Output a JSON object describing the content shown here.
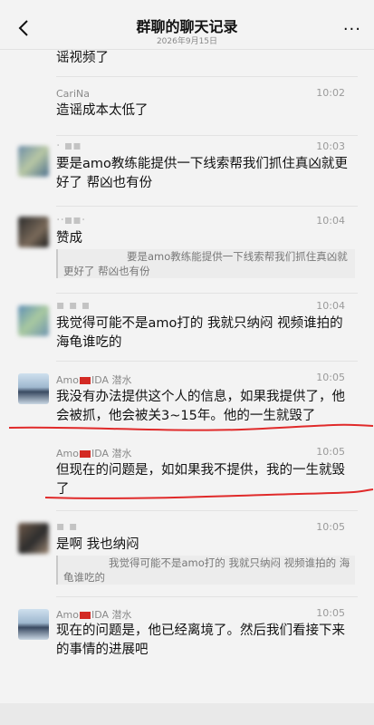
{
  "header": {
    "title": "群聊的聊天记录",
    "date": "2026年9月15日",
    "more": "···"
  },
  "messages": [
    {
      "text": "谣视频了"
    },
    {
      "name": "CariNa",
      "time": "10:02",
      "text": "造谣成本太低了"
    },
    {
      "name": "· ▪▪",
      "time": "10:03",
      "text": "要是amo教练能提供一下线索帮我们抓住真凶就更好了 帮凶也有份"
    },
    {
      "name": "··▪▪·",
      "time": "10:04",
      "text": "赞成",
      "quote": "要是amo教练能提供一下线索帮我们抓住真凶就更好了 帮凶也有份"
    },
    {
      "name": "▪ ▪ ▪",
      "time": "10:04",
      "text": "我觉得可能不是amo打的       我就只纳闷 视频谁拍的   海龟谁吃的"
    },
    {
      "name_pre": "Amo",
      "name_post": "IDA 潜水",
      "time": "10:05",
      "text": "我没有办法提供这个人的信息，如果我提供了，他会被抓，他会被关3~15年。他的一生就毁了"
    },
    {
      "name_pre": "Amo",
      "name_post": "IDA 潜水",
      "time": "10:05",
      "text": "但现在的问题是，如如果我不提供，我的一生就毁了"
    },
    {
      "name": "▪ ▪",
      "time": "10:05",
      "text": "是啊 我也纳闷",
      "quote": "我觉得可能不是amo打的       我就只纳闷 视频谁拍的  海龟谁吃的"
    },
    {
      "name_pre": "Amo",
      "name_post": "IDA 潜水",
      "time": "10:05",
      "text": "现在的问题是，他已经离境了。然后我们看接下来的事情的进展吧"
    }
  ],
  "colors": {
    "annotation": "#e02a2a",
    "flag": "#d32a24",
    "accent": "#111111"
  }
}
